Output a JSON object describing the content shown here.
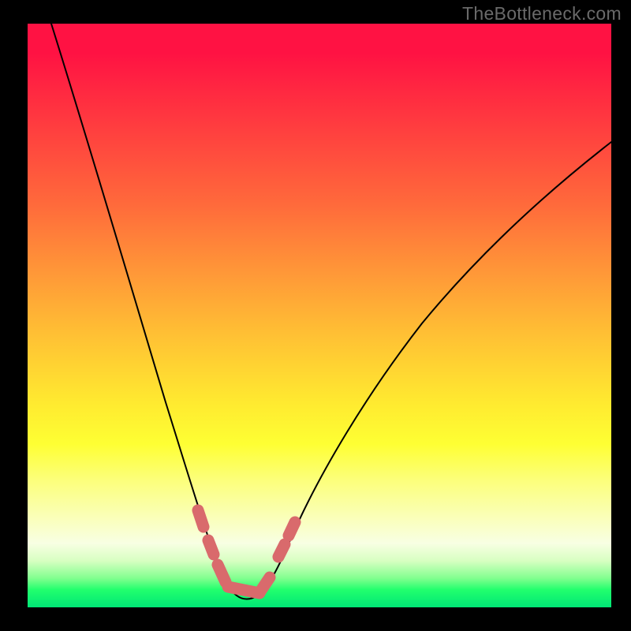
{
  "watermark": "TheBottleneck.com",
  "colors": {
    "background": "#000000",
    "curve": "#000000",
    "highlight": "#d96a6c",
    "gradient_top": "#ff1243",
    "gradient_bottom": "#00e676"
  },
  "chart_data": {
    "type": "line",
    "title": "",
    "xlabel": "",
    "ylabel": "",
    "xlim": [
      0,
      100
    ],
    "ylim": [
      0,
      100
    ],
    "x": [
      4,
      8,
      12,
      16,
      20,
      24,
      28,
      30,
      32,
      33,
      34,
      35,
      36,
      37,
      38,
      39,
      40,
      42,
      45,
      50,
      55,
      60,
      65,
      70,
      75,
      80,
      85,
      90,
      95,
      100
    ],
    "values": [
      100,
      84,
      69,
      55,
      42,
      30,
      19,
      14,
      10,
      8,
      5,
      3,
      2,
      1,
      1,
      2,
      3,
      6,
      11,
      20,
      28,
      36,
      43,
      50,
      56,
      62,
      67,
      72,
      76,
      80
    ],
    "highlight_segments": [
      {
        "x": [
          29.5,
          30.5
        ],
        "y": [
          15,
          12
        ]
      },
      {
        "x": [
          31.2,
          32.0
        ],
        "y": [
          10,
          8
        ]
      },
      {
        "x": [
          32.5,
          34.0
        ],
        "y": [
          6,
          3
        ]
      },
      {
        "x": [
          34.0,
          38.5
        ],
        "y": [
          2,
          2
        ]
      },
      {
        "x": [
          38.5,
          40.0
        ],
        "y": [
          3,
          5
        ]
      },
      {
        "x": [
          42.0,
          43.5
        ],
        "y": [
          8,
          10
        ]
      },
      {
        "x": [
          44.0,
          45.0
        ],
        "y": [
          11,
          13
        ]
      }
    ],
    "notes": "No axis ticks or labels are visible; x and y values are approximate percentages estimated from pixel positions. Curve is a bottleneck-style V with minimum near x≈36."
  }
}
